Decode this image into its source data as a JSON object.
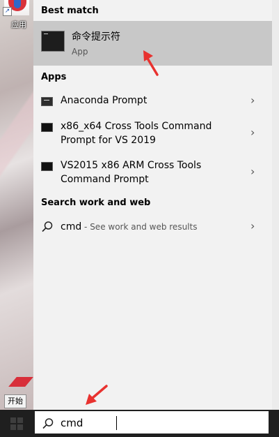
{
  "desktop": {
    "icon_label": "应用",
    "tooltip": "开始"
  },
  "search_panel": {
    "best_match_heading": "Best match",
    "best_match": {
      "title": "命令提示符",
      "subtitle": "App"
    },
    "apps_heading": "Apps",
    "apps": [
      {
        "label": "Anaconda Prompt"
      },
      {
        "label": "x86_x64 Cross Tools Command Prompt for VS 2019"
      },
      {
        "label": "VS2015 x86 ARM Cross Tools Command Prompt"
      }
    ],
    "search_web_heading": "Search work and web",
    "web_result": {
      "query": "cmd",
      "suffix": " - See work and web results"
    }
  },
  "taskbar": {
    "search_value": "cmd"
  },
  "colors": {
    "annotation": "#e8322f",
    "highlight": "#c8c8c8",
    "panel": "#f2f2f2"
  }
}
